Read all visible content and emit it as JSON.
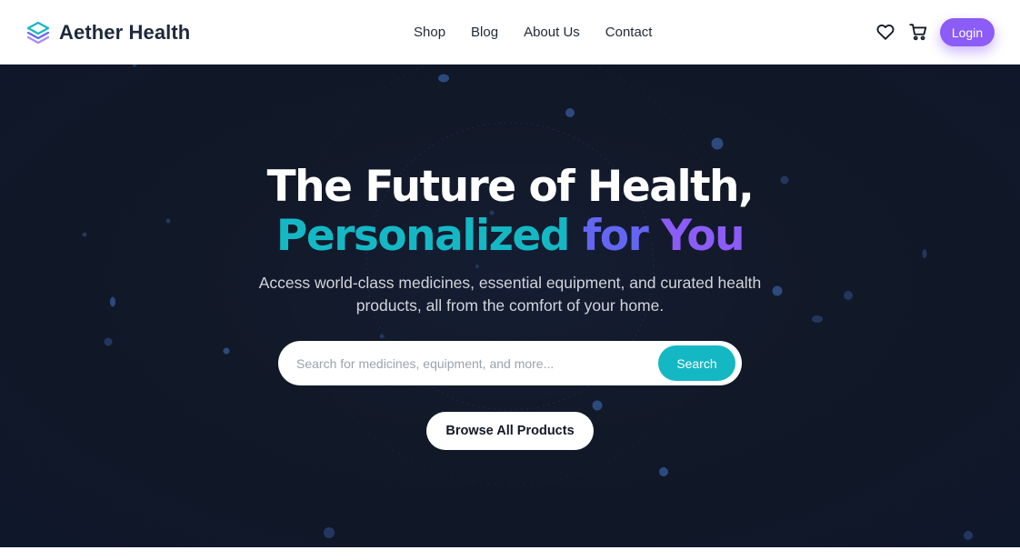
{
  "navbar": {
    "brand": {
      "name": "Aether Health",
      "icon": "layers-icon"
    },
    "links": [
      {
        "label": "Shop"
      },
      {
        "label": "Blog"
      },
      {
        "label": "About Us"
      },
      {
        "label": "Contact"
      }
    ],
    "icons": {
      "wishlist": "heart-icon",
      "cart": "cart-icon"
    },
    "login_label": "Login"
  },
  "hero": {
    "title_line1": "The Future of Health,",
    "title_line2": {
      "word1": "Personalized",
      "word2": "for",
      "word3": "You"
    },
    "subtitle": "Access world-class medicines, essential equipment, and curated health products, all from the comfort of your home.",
    "search": {
      "placeholder": "Search for medicines, equipment, and more...",
      "value": "",
      "button_label": "Search"
    },
    "browse_label": "Browse All Products"
  },
  "colors": {
    "brand_purple": "#8b5cf6",
    "brand_teal": "#14b8c4",
    "brand_indigo": "#6366f1",
    "hero_background": "#111827",
    "nav_text": "#1f2937"
  }
}
